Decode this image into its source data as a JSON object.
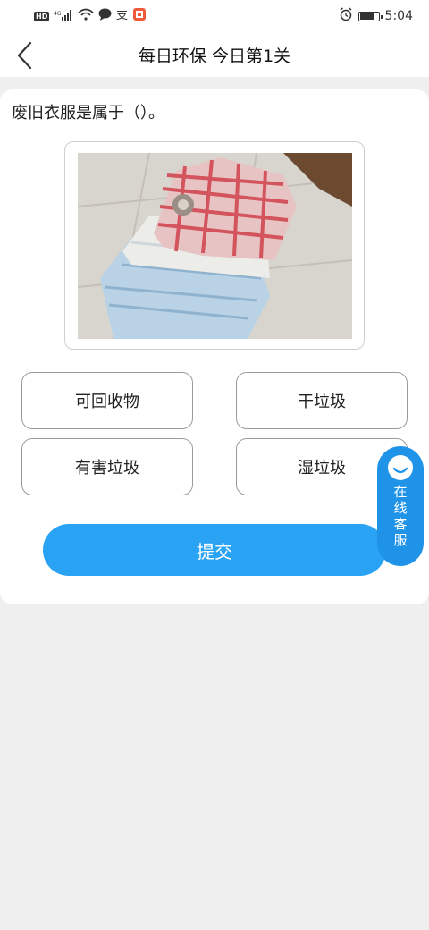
{
  "status_bar": {
    "network": "HD",
    "signal": "⁴ᴳ",
    "time": "5:04"
  },
  "nav": {
    "title": "每日环保 今日第1关"
  },
  "question": {
    "text": "废旧衣服是属于（）。"
  },
  "options": [
    {
      "label": "可回收物"
    },
    {
      "label": "干垃圾"
    },
    {
      "label": "有害垃圾"
    },
    {
      "label": "湿垃圾"
    }
  ],
  "submit": {
    "label": "提交"
  },
  "customer_service": {
    "label": "在线客服"
  },
  "colors": {
    "accent": "#2aa3f5",
    "float_button": "#1f93e8",
    "background": "#efefef"
  }
}
